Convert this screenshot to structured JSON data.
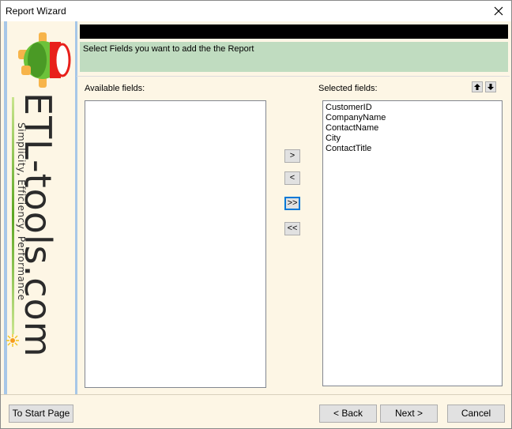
{
  "window": {
    "title": "Report Wizard"
  },
  "icons": {
    "close": "close-icon",
    "up": "arrow-up-icon",
    "down": "arrow-down-icon",
    "logo": "etl-tools-logo",
    "sun": "sun-icon"
  },
  "banner": {
    "logo_text": "ETL-tools.com",
    "tagline": "Simplicity, Efficiency, Performance"
  },
  "header": {
    "instruction": "Select Fields you want to add the the Report"
  },
  "available": {
    "label": "Available fields:",
    "items": []
  },
  "selected": {
    "label": "Selected fields:",
    "items": [
      "CustomerID",
      "CompanyName",
      "ContactName",
      "City",
      "ContactTitle"
    ]
  },
  "move_buttons": {
    "add": ">",
    "remove": "<",
    "add_all": ">>",
    "remove_all": "<<"
  },
  "footer": {
    "start_page": "To Start Page",
    "back": "< Back",
    "next": "Next >",
    "cancel": "Cancel"
  },
  "colors": {
    "header_green": "#c0dcc0",
    "banner_background": "#fdf6e5",
    "banner_border": "#a7c7e7",
    "focus_blue": "#0078d7"
  }
}
